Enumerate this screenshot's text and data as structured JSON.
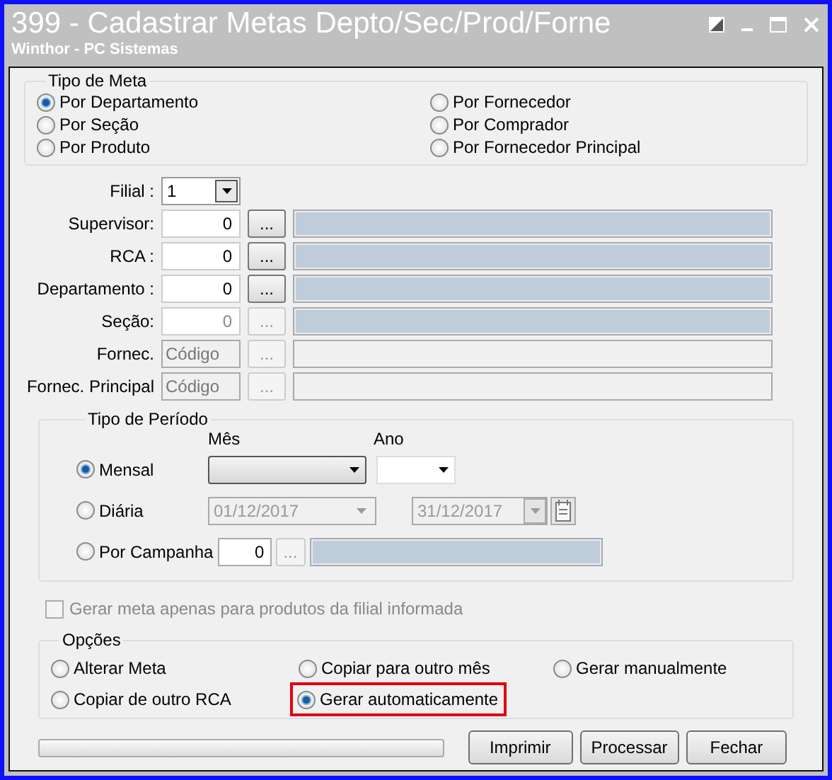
{
  "window": {
    "title": "399 - Cadastrar Metas Depto/Sec/Prod/Forne",
    "subtitle": "Winthor - PC Sistemas"
  },
  "tipo_meta": {
    "title": "Tipo de Meta",
    "options": [
      {
        "label": "Por Departamento",
        "selected": true
      },
      {
        "label": "Por Seção",
        "selected": false
      },
      {
        "label": "Por Produto",
        "selected": false
      },
      {
        "label": "Por Fornecedor",
        "selected": false
      },
      {
        "label": "Por Comprador",
        "selected": false
      },
      {
        "label": "Por Fornecedor Principal",
        "selected": false
      }
    ]
  },
  "fields": [
    {
      "kind": "combo",
      "label": "Filial :",
      "value": "1",
      "disabled": false
    },
    {
      "kind": "lookup",
      "label": "Supervisor:",
      "value": "0",
      "button": "...",
      "disabled": false
    },
    {
      "kind": "lookup",
      "label": "RCA :",
      "value": "0",
      "button": "...",
      "disabled": false
    },
    {
      "kind": "lookup",
      "label": "Departamento :",
      "value": "0",
      "button": "...",
      "disabled": false
    },
    {
      "kind": "lookup",
      "label": "Seção:",
      "value": "0",
      "button": "...",
      "disabled": true
    },
    {
      "kind": "code",
      "label": "Fornec.",
      "placeholder": "Código",
      "button": "...",
      "disabled": true
    },
    {
      "kind": "code",
      "label": "Fornec. Principal",
      "placeholder": "Código",
      "button": "...",
      "disabled": true
    }
  ],
  "periodo": {
    "title": "Tipo de Período",
    "month_label": "Mês",
    "year_label": "Ano",
    "modes": [
      {
        "kind": "monthly",
        "label": "Mensal",
        "selected": true
      },
      {
        "kind": "daily",
        "label": "Diária",
        "selected": false,
        "start": "01/12/2017",
        "end": "31/12/2017"
      },
      {
        "kind": "campaign",
        "label": "Por Campanha",
        "selected": false,
        "value": "0",
        "button": "..."
      }
    ]
  },
  "filial_only": {
    "label": "Gerar meta apenas para produtos da filial informada",
    "checked": false,
    "disabled": true
  },
  "opcoes": {
    "title": "Opções",
    "options": [
      {
        "label": "Alterar Meta",
        "selected": false,
        "highlighted": false
      },
      {
        "label": "Copiar para outro mês",
        "selected": false,
        "highlighted": false
      },
      {
        "label": "Gerar manualmente",
        "selected": false,
        "highlighted": false
      },
      {
        "label": "Copiar de outro RCA",
        "selected": false,
        "highlighted": false
      },
      {
        "label": "Gerar automaticamente",
        "selected": true,
        "highlighted": true
      }
    ]
  },
  "progress": {
    "level": 0
  },
  "buttons": [
    {
      "label": "Imprimir"
    },
    {
      "label": "Processar"
    },
    {
      "label": "Fechar"
    }
  ]
}
